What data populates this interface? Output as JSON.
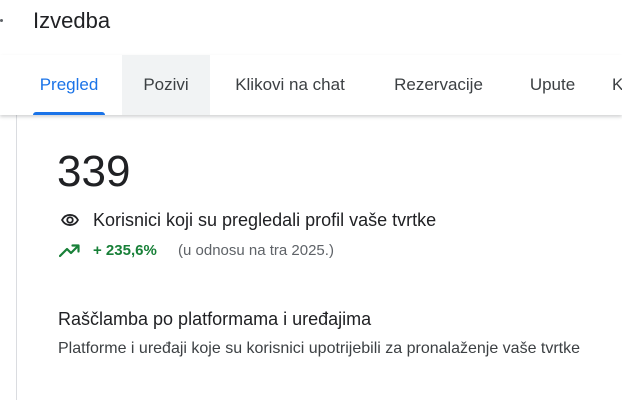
{
  "header": {
    "title": "Izvedba"
  },
  "tabs": [
    {
      "label": "Pregled",
      "active": true
    },
    {
      "label": "Pozivi",
      "active": false
    },
    {
      "label": "Klikovi na chat",
      "active": false
    },
    {
      "label": "Rezervacije",
      "active": false
    },
    {
      "label": "Upute",
      "active": false
    },
    {
      "label": "K",
      "active": false
    }
  ],
  "metric": {
    "value": "339",
    "icon": "eye-icon",
    "label": "Korisnici koji su pregledali profil vaše tvrtke",
    "trend_icon": "trending-up-icon",
    "change": "+ 235,6%",
    "comparison": "(u odnosu na tra 2025.)"
  },
  "breakdown": {
    "title": "Raščlamba po platformama i uređajima",
    "description": "Platforme i uređaji koje su korisnici upotrijebili za pronalaženje vaše tvrtke"
  },
  "colors": {
    "accent": "#1a73e8",
    "positive": "#188038"
  }
}
